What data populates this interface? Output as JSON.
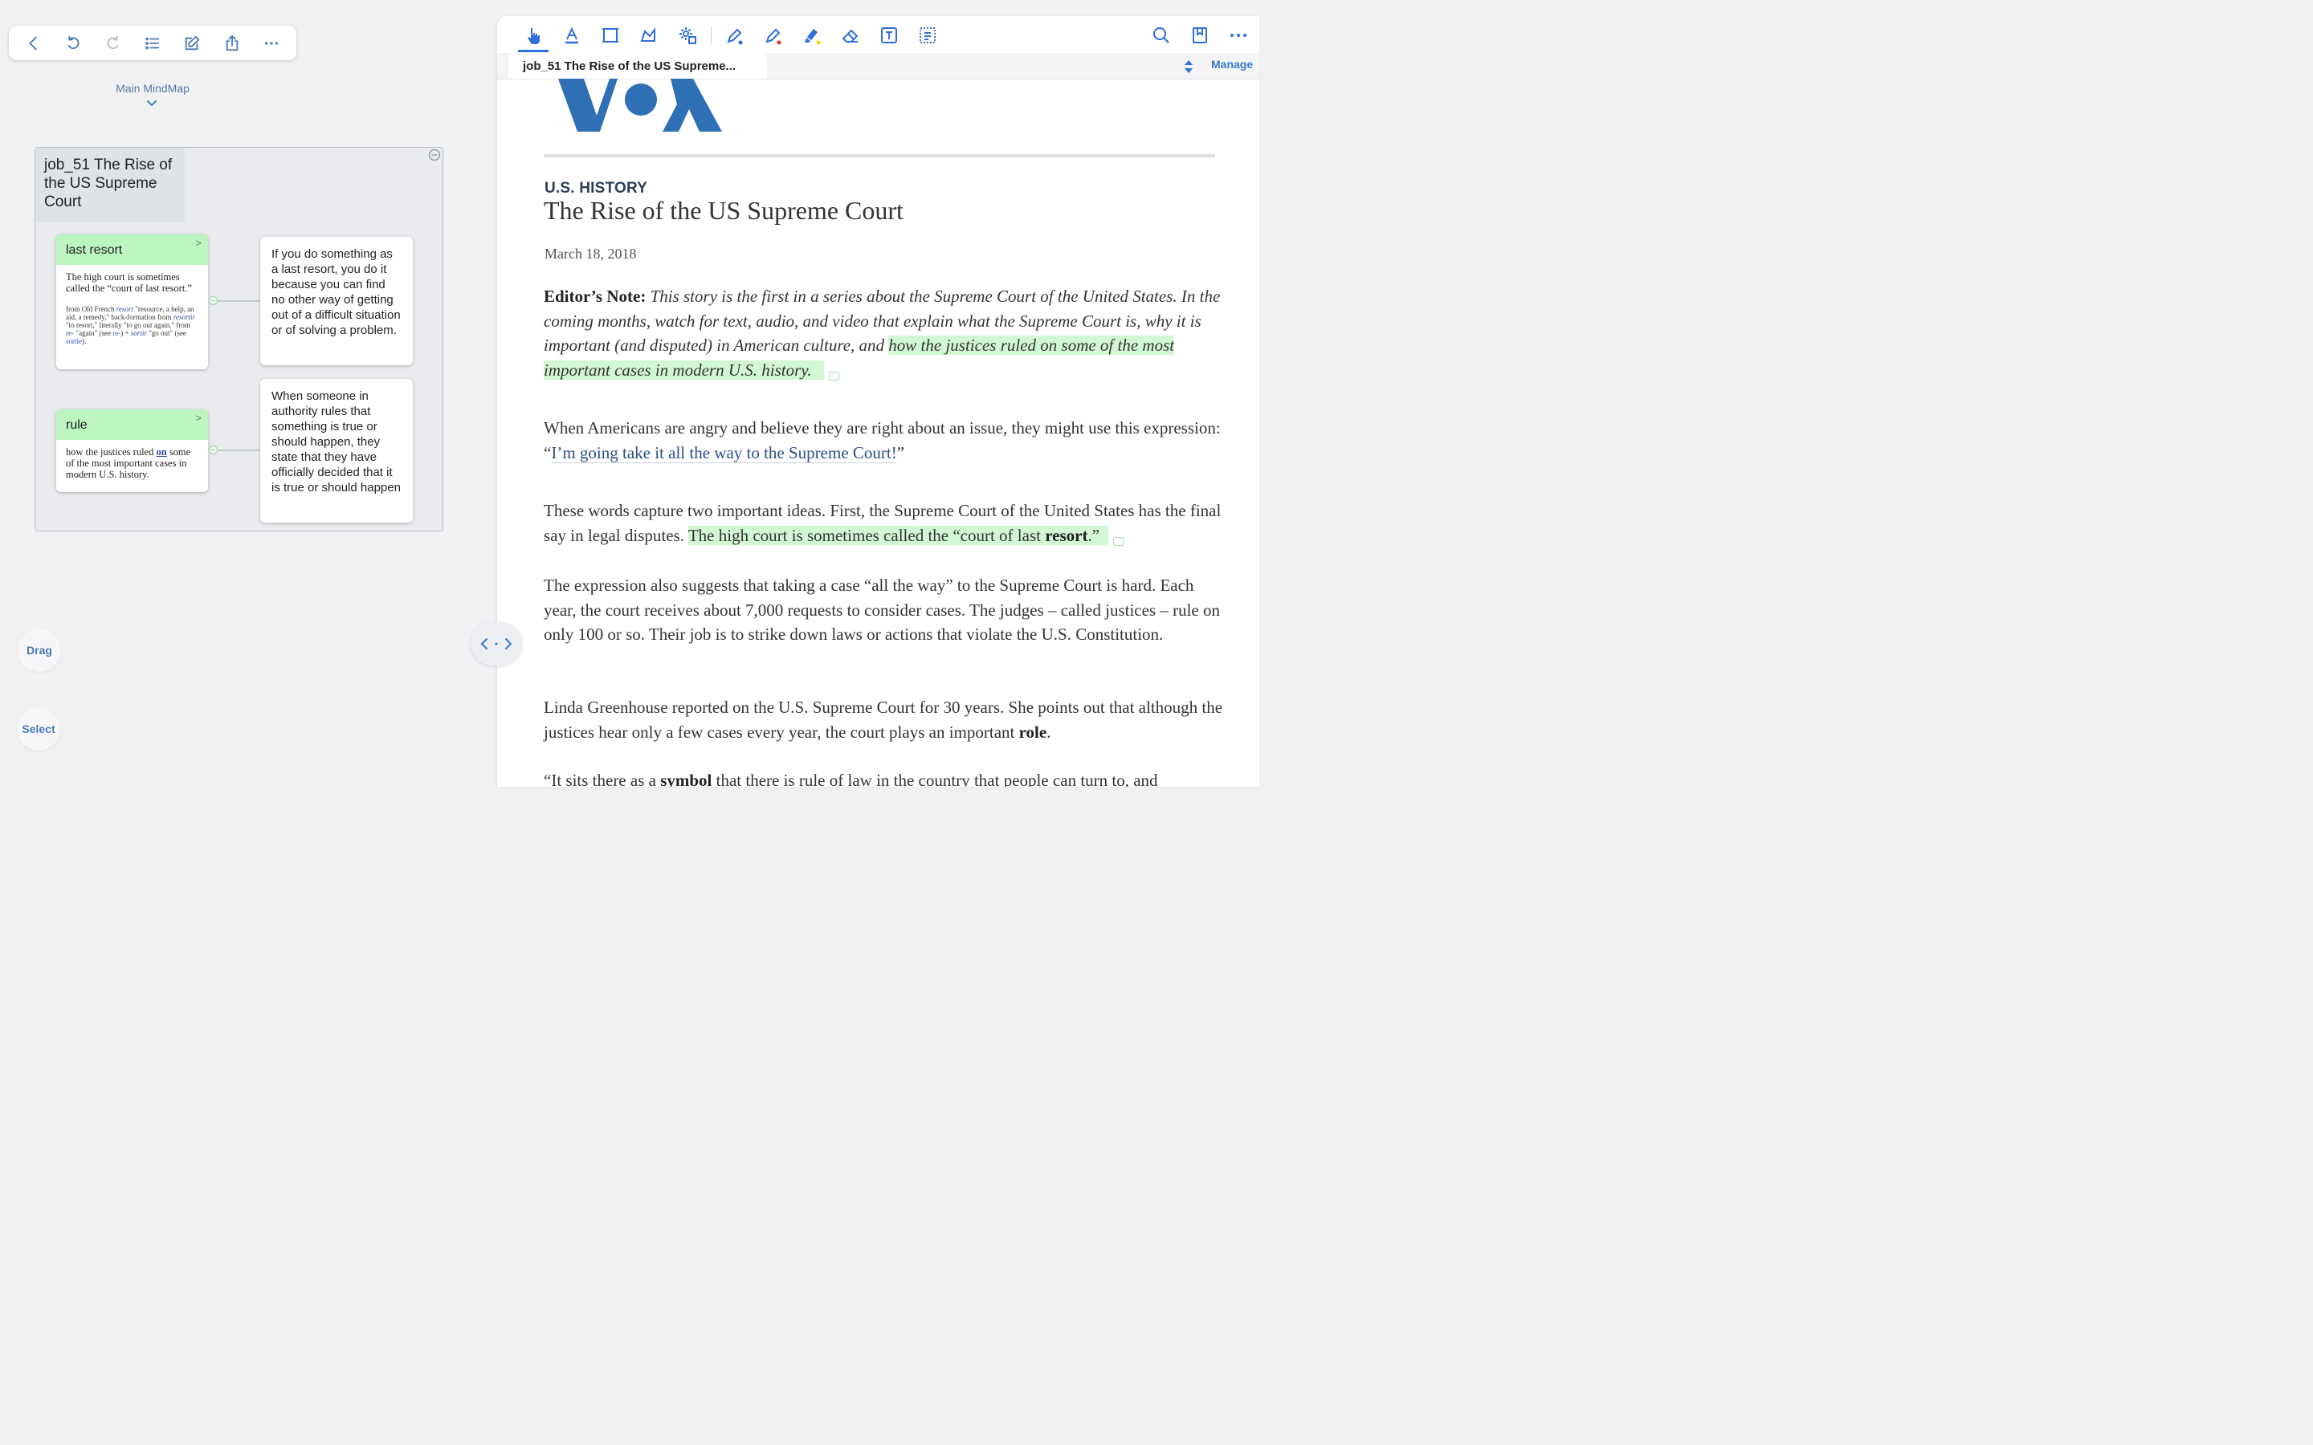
{
  "mindmap": {
    "breadcrumb": "Main MindMap",
    "root_title": "job_51 The Rise of the US Supreme Court",
    "nodes": [
      {
        "term": "last resort",
        "example": "The high court is sometimes called the “court of last resort.”",
        "etymology": {
          "t1": "from Old French ",
          "w1": "resort",
          "t2": " \"resource, a help, an aid, a remedy,\" back-formation from ",
          "w2": "resortir",
          "t3": " \"to resort,\" literally \"to go out again,\" from ",
          "w3": "re-",
          "t4": " \"again\" (see ",
          "l1": "re-",
          "t5": ") + ",
          "w4": "sortir",
          "t6": " \"go out\" (see ",
          "l2": "sortie",
          "t7": ")."
        },
        "definition": "If you do something as a last resort, you do it because you can find no other way of getting out of a difficult situation or of solving a problem."
      },
      {
        "term": "rule",
        "example_before": "how the justices ruled ",
        "example_emph": "on",
        "example_after": " some of the most important cases in modern U.S. history.",
        "definition": "When someone in authority rules that something is true or should happen, they state that they have officially decided that it is true or should happen"
      }
    ],
    "drag_label": "Drag",
    "select_label": "Select"
  },
  "document": {
    "tab_title": "job_51 The Rise of the US Supreme...",
    "manage_label": "Manage",
    "kicker": "U.S. HISTORY",
    "headline": "The Rise of the US Supreme Court",
    "date": "March 18, 2018",
    "p1": {
      "lead": "Editor’s Note:",
      "italic": " This story is the first in a series about the Supreme Court of the United States. In the coming months, watch for text, audio, and video that explain what the Supreme Court is, why it is important (and disputed) in American culture, and ",
      "highlight": "how the justices ruled on some of the most important cases in modern U.S. history."
    },
    "p2": {
      "text": "When Americans are angry and believe they are right about an issue, they might use this expression: “",
      "link": "I’m going take it all the way to the Supreme Court!",
      "end": "”"
    },
    "p3": {
      "text": "These words capture two important ideas. First, the Supreme Court of the United States has the final say in legal disputes. ",
      "highlight": "The high court is sometimes called the “court of last ",
      "bold": "resort",
      "highlight_end": ".”"
    },
    "p4": "The expression also suggests that taking a case “all the way” to the Supreme Court is hard. Each year, the court receives about 7,000 requests to consider cases. The judges – called justices – rule on only 100 or so. Their job is to strike down laws or actions that violate the U.S. Constitution.",
    "p5": {
      "text": "Linda Greenhouse reported on the U.S. Supreme Court for 30 years. She points out that although the justices hear only a few cases every year, the court plays an important ",
      "bold": "role",
      "end": "."
    },
    "p6": {
      "text": "“It sits there as a ",
      "bold": "symbol",
      "end": " that there is rule of law in the country that people can turn to, and"
    }
  },
  "colors": {
    "accent": "#2f6fdb",
    "highlight": "#d2f7d3",
    "term_header": "#bdf5c0",
    "voa_blue": "#2e6fb5"
  }
}
